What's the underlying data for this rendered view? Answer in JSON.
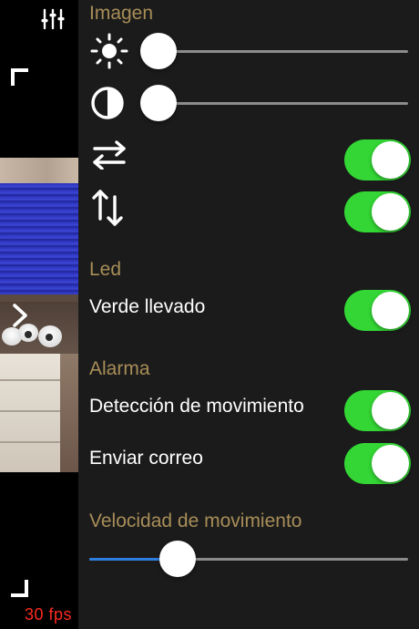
{
  "camera": {
    "fps_label": "30 fps"
  },
  "panel": {
    "image_section": "Imagen",
    "led_section": "Led",
    "led_green_label": "Verde llevado",
    "alarm_section": "Alarma",
    "motion_detection_label": "Detección de movimiento",
    "send_email_label": "Enviar correo",
    "motion_speed_section": "Velocidad de movimiento"
  },
  "controls": {
    "brightness_level": 0,
    "contrast_level": 0,
    "flip_horizontal": true,
    "flip_vertical": true,
    "led_green": true,
    "motion_detection": true,
    "send_email": true,
    "motion_speed_level": 0.28
  },
  "icons": {
    "settings": "sliders-icon",
    "brightness": "sun-icon",
    "contrast": "contrast-icon",
    "flip_horizontal": "horizontal-arrows-icon",
    "flip_vertical": "vertical-arrows-icon",
    "expand": "chevron-right-icon"
  },
  "colors": {
    "panel_bg": "#1b1b1c",
    "section_label": "#a88e57",
    "toggle_on": "#33d634",
    "slider_fill": "#2f7fe0",
    "fps_text": "#ff2a1f"
  }
}
